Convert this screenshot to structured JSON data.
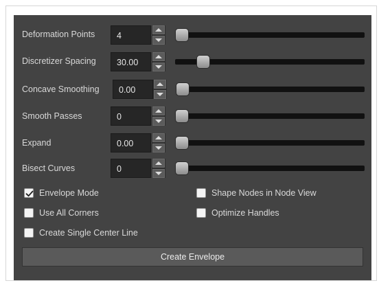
{
  "rows": [
    {
      "label": "Deformation Points",
      "value": "4",
      "slider_fraction": 0.0
    },
    {
      "label": "Discretizer Spacing",
      "value": "30.00",
      "slider_fraction": 0.12
    },
    {
      "label": "Concave Smoothing",
      "value": "0.00",
      "slider_fraction": 0.0
    },
    {
      "label": "Smooth Passes",
      "value": "0",
      "slider_fraction": 0.0
    },
    {
      "label": "Expand",
      "value": "0.00",
      "slider_fraction": 0.0
    },
    {
      "label": "Bisect Curves",
      "value": "0",
      "slider_fraction": 0.0
    }
  ],
  "checkboxes": [
    {
      "label": "Envelope Mode",
      "checked": true
    },
    {
      "label": "Use All Corners",
      "checked": false
    },
    {
      "label": "Create Single Center Line",
      "checked": false
    },
    {
      "label": "Shape Nodes in Node View",
      "checked": false
    },
    {
      "label": "Optimize Handles",
      "checked": false
    }
  ],
  "create_button_label": "Create Envelope",
  "colors": {
    "panel_bg": "#434343",
    "field_bg": "#262626",
    "track": "#111111",
    "button_bg": "#5a5a5a"
  }
}
